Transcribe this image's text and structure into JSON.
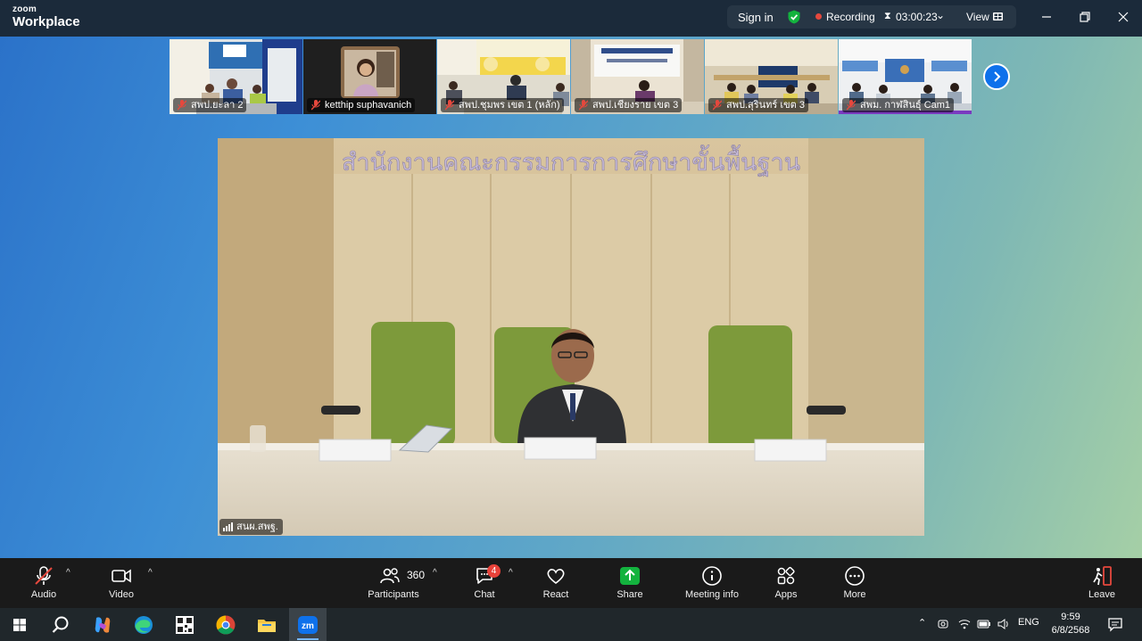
{
  "app": {
    "logo_top": "zoom",
    "logo_bottom": "Workplace"
  },
  "status_bar": {
    "signin_label": "Sign in",
    "recording_label": "Recording",
    "timer": "03:00:23",
    "view_label": "View"
  },
  "thumbnails": [
    {
      "label": "สพป.ยะลา 2"
    },
    {
      "label": "ketthip suphavanich"
    },
    {
      "label": "สพป.ชุมพร เขต 1 (หลัก)"
    },
    {
      "label": "สพป.เชียงราย เขต 3"
    },
    {
      "label": "สพป.สุรินทร์ เขต 3"
    },
    {
      "label": "สพม. กาฬสินธุ์ Cam1"
    }
  ],
  "main_video": {
    "speaker_label": "สนผ.สพฐ.",
    "wall_banner": "สำนักงานคณะกรรมการการศึกษาขั้นพื้นฐาน"
  },
  "toolbar": {
    "audio": "Audio",
    "video": "Video",
    "participants": "Participants",
    "participants_count": "360",
    "chat": "Chat",
    "chat_badge": "4",
    "react": "React",
    "share": "Share",
    "meeting_info": "Meeting info",
    "apps": "Apps",
    "more": "More",
    "leave": "Leave"
  },
  "taskbar": {
    "language": "ENG",
    "time": "9:59",
    "date": "6/8/2568"
  },
  "colors": {
    "zoom_blue": "#0e71eb",
    "share_green": "#13b33e",
    "leave_red": "#e5483d",
    "record_red": "#e5483d",
    "shield_green": "#13b33e"
  },
  "icons": [
    "mic-muted-icon",
    "video-icon",
    "participants-icon",
    "chat-icon",
    "react-heart-icon",
    "share-arrow-icon",
    "info-icon",
    "apps-icon",
    "more-icon",
    "leave-icon",
    "shield-check-icon",
    "hourglass-icon",
    "chevron-right-icon",
    "signal-bars-icon"
  ]
}
